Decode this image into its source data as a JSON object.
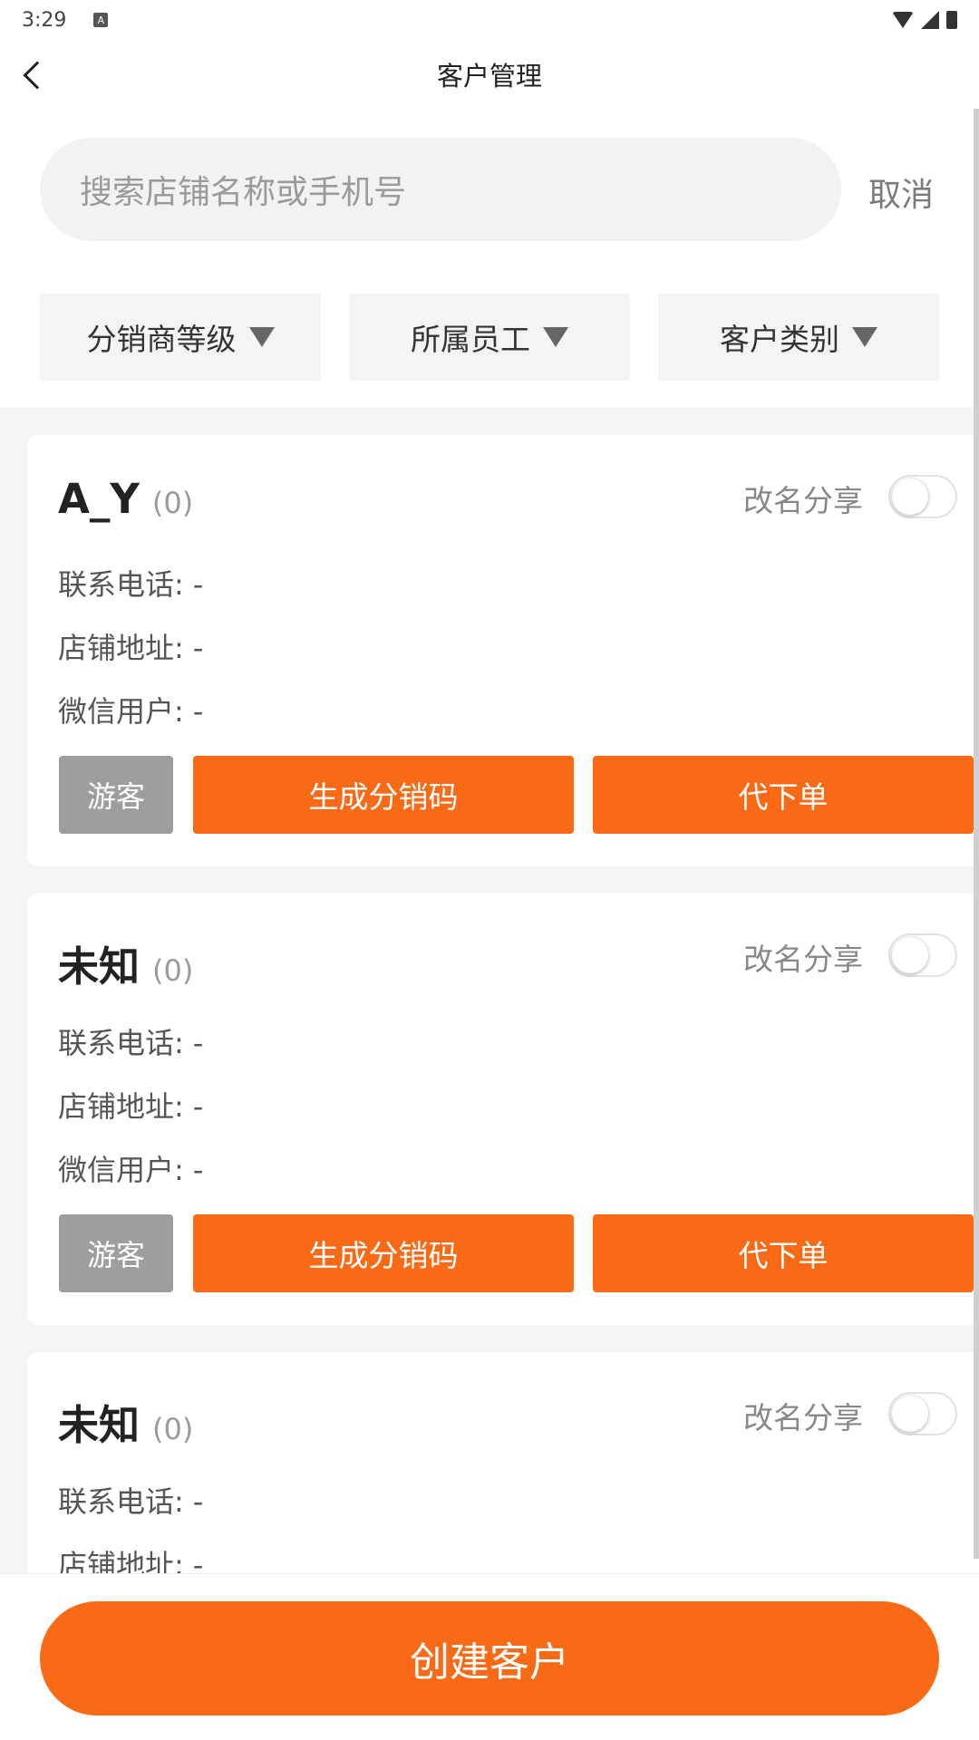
{
  "status_bar": {
    "time": "3:29",
    "badge": "A"
  },
  "header": {
    "title": "客户管理"
  },
  "search": {
    "placeholder": "搜索店铺名称或手机号",
    "cancel_label": "取消"
  },
  "filters": [
    {
      "label": "分销商等级"
    },
    {
      "label": "所属员工"
    },
    {
      "label": "客户类别"
    }
  ],
  "card_labels": {
    "share": "改名分享",
    "phone": "联系电话:",
    "address": "店铺地址:",
    "wechat": "微信用户:",
    "guest": "游客",
    "gen_code": "生成分销码",
    "place_order": "代下单"
  },
  "customers": [
    {
      "name": "A_Y",
      "count": "(0)",
      "phone": "-",
      "address": "-",
      "wechat": "-"
    },
    {
      "name": "未知",
      "count": "(0)",
      "phone": "-",
      "address": "-",
      "wechat": "-"
    },
    {
      "name": "未知",
      "count": "(0)",
      "phone": "-",
      "address": "-",
      "wechat": "-"
    }
  ],
  "bottom": {
    "create_label": "创建客户"
  }
}
